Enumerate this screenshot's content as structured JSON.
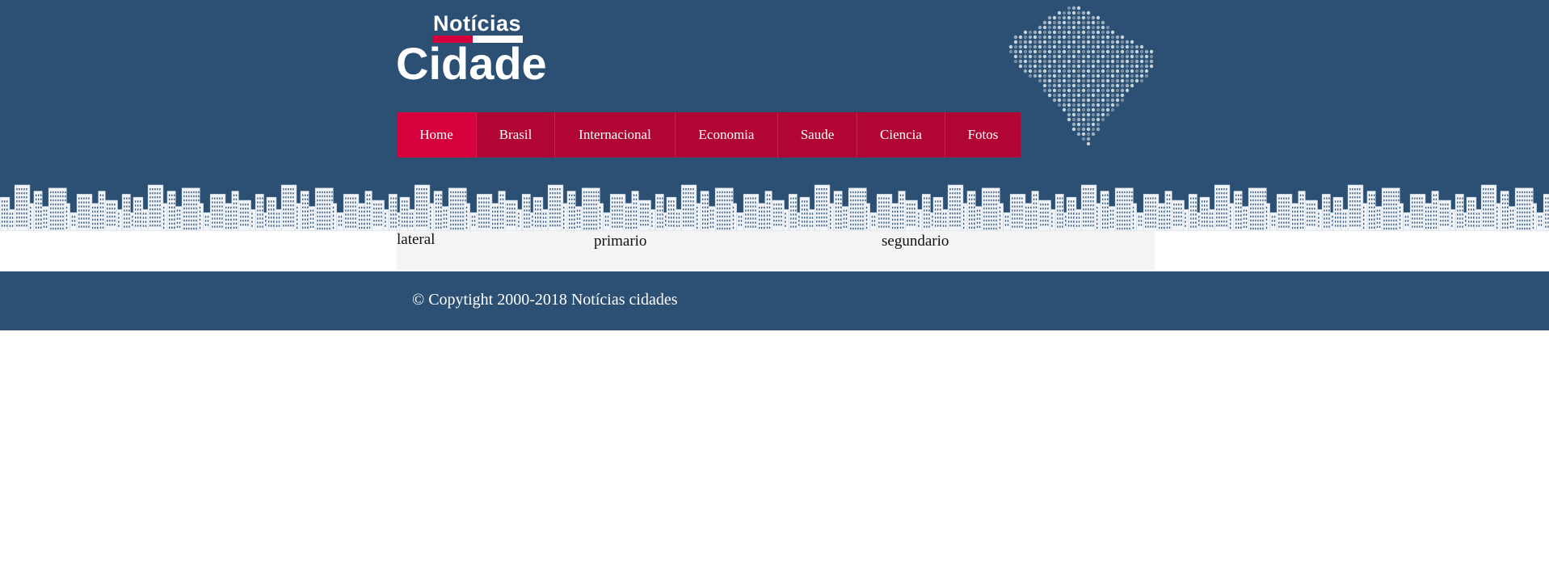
{
  "logo": {
    "top": "Notícias",
    "main": "Cidade"
  },
  "nav": {
    "items": [
      {
        "label": "Home",
        "active": true
      },
      {
        "label": "Brasil"
      },
      {
        "label": "Internacional"
      },
      {
        "label": "Economia"
      },
      {
        "label": "Saude"
      },
      {
        "label": "Ciencia"
      },
      {
        "label": "Fotos"
      }
    ]
  },
  "content": {
    "lateral": "lateral",
    "primario": "primario",
    "segundario": "segundario"
  },
  "footer": {
    "copyright": "© Copytight 2000-2018 Notícias cidades"
  },
  "colors": {
    "header_bg": "#2b5073",
    "nav_bg": "#b00535",
    "nav_active": "#d6003c",
    "content_bg": "#f4f4f4"
  },
  "icons": {
    "map": "brazil-map-dots-icon",
    "skyline": "city-skyline-icon"
  }
}
